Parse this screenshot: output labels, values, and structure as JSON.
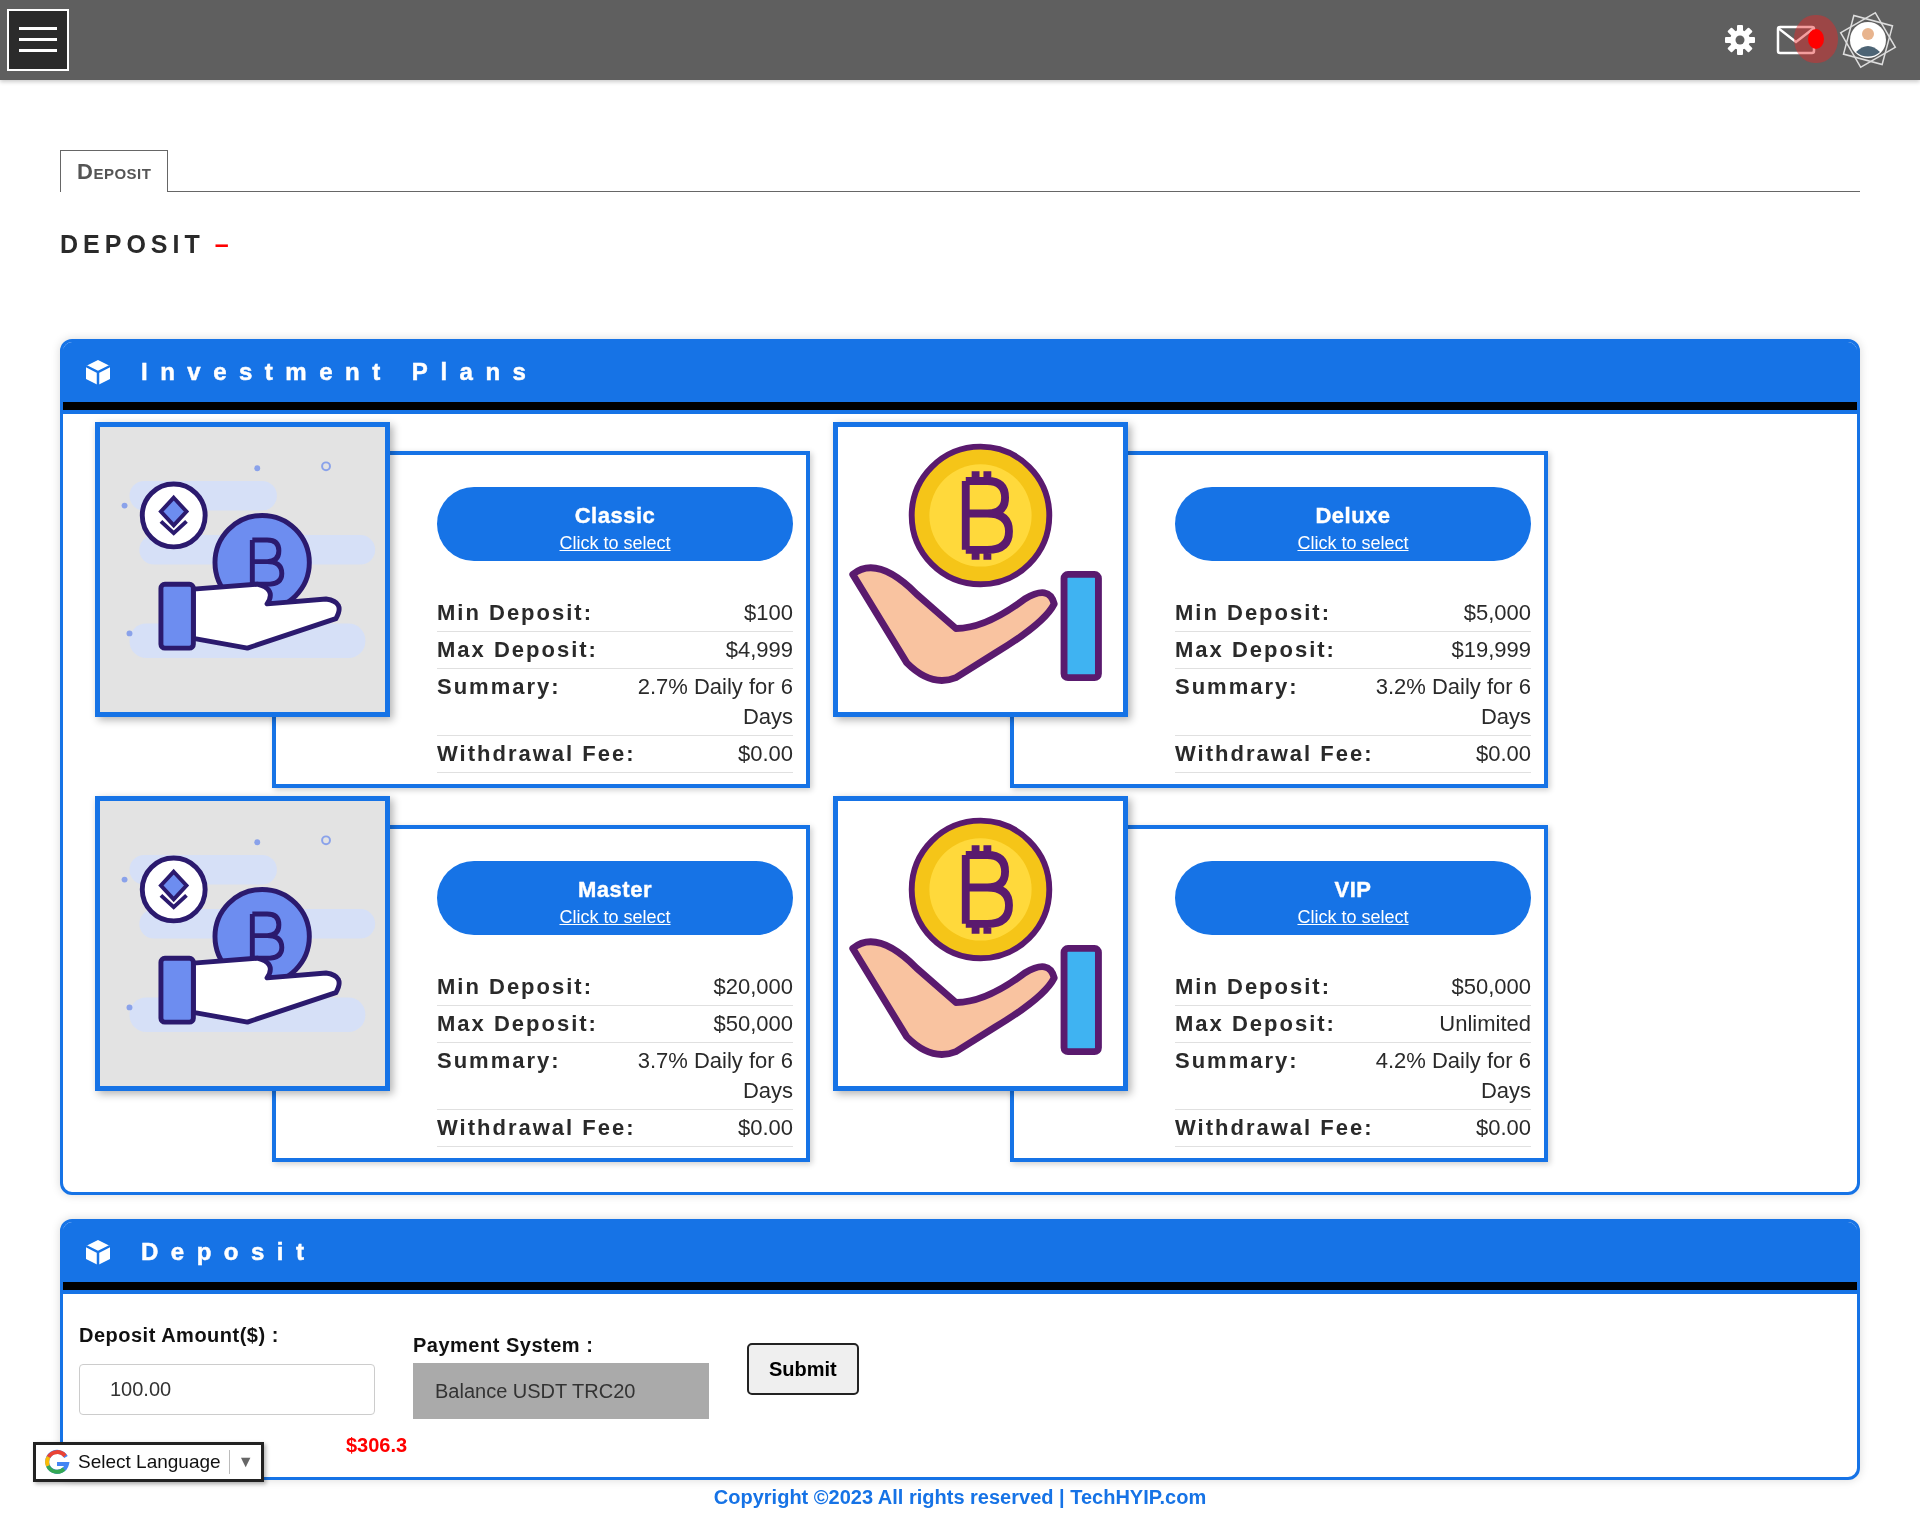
{
  "topbar": {
    "mail": {
      "unread": true
    }
  },
  "tabs": [
    {
      "label": "Deposit",
      "selected": true
    }
  ],
  "page_heading": {
    "title": "DEPOSIT",
    "mark": "–"
  },
  "plans_panel": {
    "title": "Investment Plans",
    "plans": [
      {
        "kind": "outline",
        "name": "Classic",
        "link": "Click to select",
        "rows": [
          {
            "label": "Min Deposit:",
            "value": "$100"
          },
          {
            "label": "Max Deposit:",
            "value": "$4,999"
          },
          {
            "label": "Summary:",
            "value": "2.7% Daily for 6 Days"
          },
          {
            "label": "Withdrawal Fee:",
            "value": "$0.00"
          }
        ]
      },
      {
        "kind": "gold",
        "name": "Deluxe",
        "link": "Click to select",
        "rows": [
          {
            "label": "Min Deposit:",
            "value": "$5,000"
          },
          {
            "label": "Max Deposit:",
            "value": "$19,999"
          },
          {
            "label": "Summary:",
            "value": "3.2% Daily for 6 Days"
          },
          {
            "label": "Withdrawal Fee:",
            "value": "$0.00"
          }
        ]
      },
      {
        "kind": "outline",
        "name": "Master",
        "link": "Click to select",
        "rows": [
          {
            "label": "Min Deposit:",
            "value": "$20,000"
          },
          {
            "label": "Max Deposit:",
            "value": "$50,000"
          },
          {
            "label": "Summary:",
            "value": "3.7% Daily for 6 Days"
          },
          {
            "label": "Withdrawal Fee:",
            "value": "$0.00"
          }
        ]
      },
      {
        "kind": "gold",
        "name": "VIP",
        "link": "Click to select",
        "rows": [
          {
            "label": "Min Deposit:",
            "value": "$50,000"
          },
          {
            "label": "Max Deposit:",
            "value": "Unlimited"
          },
          {
            "label": "Summary:",
            "value": "4.2% Daily for 6 Days"
          },
          {
            "label": "Withdrawal Fee:",
            "value": "$0.00"
          }
        ]
      }
    ]
  },
  "deposit_panel": {
    "title": "Deposit",
    "amount_label": "Deposit Amount($) :",
    "amount_value": "100.00",
    "payment_label": "Payment System :",
    "payment_value": "Balance USDT TRC20",
    "submit": "Submit",
    "balance": "$306.3"
  },
  "language_widget": {
    "label": "Select Language",
    "caret": "▼"
  },
  "footer": {
    "copyright": "Copyright ©2023 All rights reserved | TechHYIP.com"
  }
}
